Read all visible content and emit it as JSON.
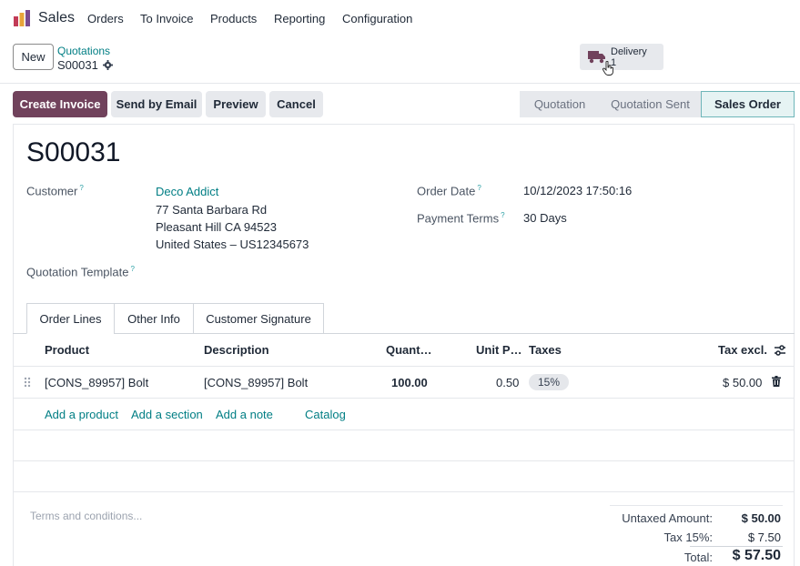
{
  "nav": {
    "app_name": "Sales",
    "menu": [
      "Orders",
      "To Invoice",
      "Products",
      "Reporting",
      "Configuration"
    ]
  },
  "control": {
    "new_label": "New",
    "breadcrumb": "Quotations",
    "record": "S00031",
    "smart_button": {
      "label": "Delivery",
      "count": "1"
    }
  },
  "actions": {
    "create_invoice": "Create Invoice",
    "send_email": "Send by Email",
    "preview": "Preview",
    "cancel": "Cancel"
  },
  "statusbar": [
    "Quotation",
    "Quotation Sent",
    "Sales Order"
  ],
  "form": {
    "title": "S00031",
    "customer_label": "Customer",
    "customer_name": "Deco Addict",
    "address": [
      "77 Santa Barbara Rd",
      "Pleasant Hill CA 94523",
      "United States – US12345673"
    ],
    "template_label": "Quotation Template",
    "order_date_label": "Order Date",
    "order_date": "10/12/2023 17:50:16",
    "payment_terms_label": "Payment Terms",
    "payment_terms": "30 Days"
  },
  "tabs": [
    "Order Lines",
    "Other Info",
    "Customer Signature"
  ],
  "table": {
    "headers": [
      "Product",
      "Description",
      "Quant…",
      "Unit P…",
      "Taxes",
      "Tax excl."
    ],
    "rows": [
      {
        "product": "[CONS_89957] Bolt",
        "description": "[CONS_89957] Bolt",
        "quantity": "100.00",
        "unit_price": "0.50",
        "taxes": "15%",
        "subtotal": "$ 50.00"
      }
    ],
    "add_links": [
      "Add a product",
      "Add a section",
      "Add a note",
      "Catalog"
    ]
  },
  "footer": {
    "terms_placeholder": "Terms and conditions...",
    "untaxed_label": "Untaxed Amount:",
    "untaxed_value": "$ 50.00",
    "tax_label": "Tax 15%:",
    "tax_value": "$ 7.50",
    "total_label": "Total:",
    "total_value": "$ 57.50"
  },
  "colors": {
    "brand": "#71425c",
    "link": "#017e84"
  }
}
